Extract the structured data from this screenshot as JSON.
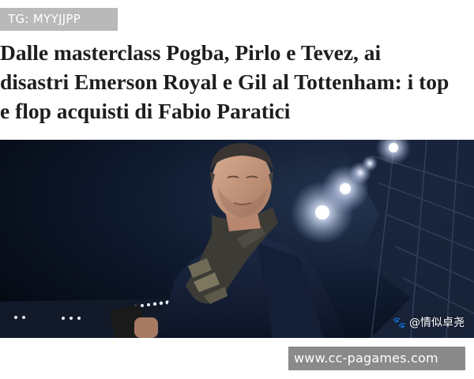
{
  "badge": {
    "text": "TG: MYYJJPP"
  },
  "headline": {
    "lines": [
      "Dalle masterclass Pogba, Pirlo e Tevez, ai",
      "disastri Emerson Royal e Gil al Tottenham: i top",
      "e flop acquisti di Fabio Paratici"
    ]
  },
  "photo": {
    "watermark_icon": "paw-icon",
    "watermark_text": "@情似卓尧"
  },
  "url_bar": {
    "text": "www.cc-pagames.com"
  },
  "colors": {
    "badge_bg": "#b9b9b9",
    "url_bg": "#8a8a8a",
    "headline_text": "#1e1e1e",
    "night_sky": "#0b1528"
  }
}
